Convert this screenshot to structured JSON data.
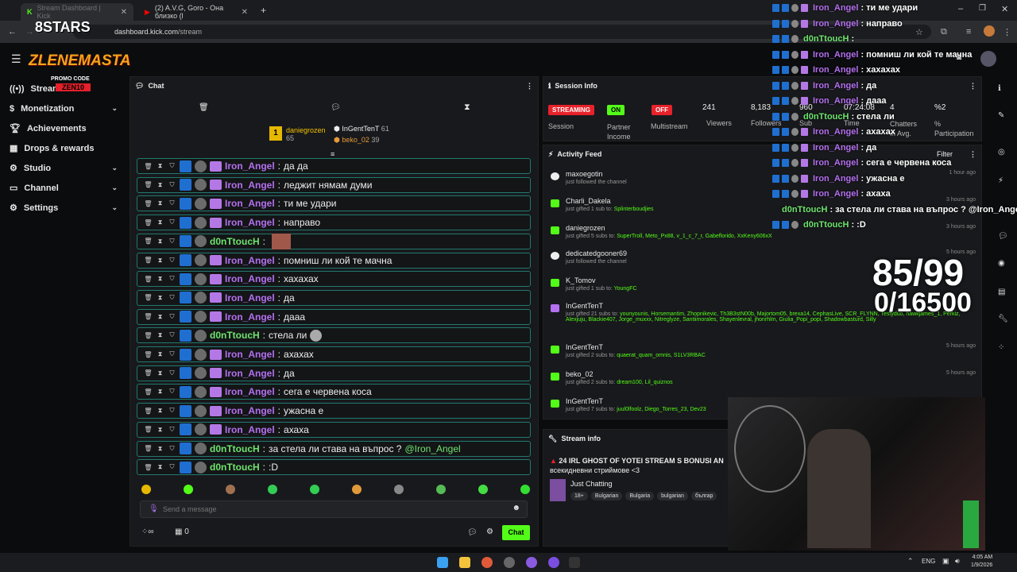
{
  "browser": {
    "tabs": [
      {
        "label": "Stream Dashboard | Kick"
      },
      {
        "label": "(2) A.V.G, Goro - Она близко (l"
      }
    ],
    "url_prefix": "dashboard.kick.com",
    "url_path": "/stream"
  },
  "logo": {
    "brand": "8STARS",
    "streamer": "ZLENEMASTA",
    "promo": "PROMO CODE",
    "code": "ZEN10"
  },
  "sidebar": {
    "items": [
      {
        "label": "Stream",
        "icon": "broadcast-icon"
      },
      {
        "label": "Monetization",
        "icon": "dollar-icon",
        "chevron": true
      },
      {
        "label": "Achievements",
        "icon": "trophy-icon"
      },
      {
        "label": "Drops & rewards",
        "icon": "gift-icon"
      },
      {
        "label": "Studio",
        "icon": "gear-icon",
        "chevron": true
      },
      {
        "label": "Channel",
        "icon": "tv-icon",
        "chevron": true
      },
      {
        "label": "Settings",
        "icon": "gear-icon",
        "chevron": true
      }
    ]
  },
  "chat": {
    "title": "Chat",
    "leaders": [
      {
        "name": "daniegrozen",
        "count": "65"
      },
      {
        "name": "InGentTenT",
        "count": "61"
      },
      {
        "name": "beko_02",
        "count": "39"
      }
    ],
    "rank": "1",
    "messages": [
      {
        "user": "Iron_Angel",
        "text": "да да",
        "color": "purple"
      },
      {
        "user": "Iron_Angel",
        "text": "леджит нямам думи",
        "color": "purple"
      },
      {
        "user": "Iron_Angel",
        "text": "ти ме удари",
        "color": "purple"
      },
      {
        "user": "Iron_Angel",
        "text": "направо",
        "color": "purple"
      },
      {
        "user": "d0nTtoucH",
        "text": "",
        "color": "green",
        "emote": true
      },
      {
        "user": "Iron_Angel",
        "text": "помниш ли кой те мачна",
        "color": "purple"
      },
      {
        "user": "Iron_Angel",
        "text": "хахахах",
        "color": "purple"
      },
      {
        "user": "Iron_Angel",
        "text": "да",
        "color": "purple"
      },
      {
        "user": "Iron_Angel",
        "text": "дааа",
        "color": "purple"
      },
      {
        "user": "d0nTtoucH",
        "text": "стела ли",
        "color": "green",
        "emote2": true
      },
      {
        "user": "Iron_Angel",
        "text": "ахахах",
        "color": "purple"
      },
      {
        "user": "Iron_Angel",
        "text": "да",
        "color": "purple"
      },
      {
        "user": "Iron_Angel",
        "text": "сега е червена коса",
        "color": "purple"
      },
      {
        "user": "Iron_Angel",
        "text": "ужасна е",
        "color": "purple"
      },
      {
        "user": "Iron_Angel",
        "text": "ахаха",
        "color": "purple"
      },
      {
        "user": "d0nTtoucH",
        "text": "за стела ли става на въпрос ?",
        "mention": "@Iron_Angel",
        "color": "green"
      },
      {
        "user": "d0nTtoucH",
        "text": ":D",
        "color": "green"
      }
    ],
    "placeholder": "Send a message",
    "chat_button": "Chat",
    "count": "0"
  },
  "session": {
    "title": "Session Info",
    "items": [
      {
        "badge": "STREAMING",
        "label": "Session"
      },
      {
        "badge": "ON",
        "label": "Partner Income"
      },
      {
        "badge": "OFF",
        "label": "Multistream"
      },
      {
        "value": "241",
        "label": "Viewers"
      },
      {
        "value": "8,183",
        "label": "Followers"
      },
      {
        "value": "960",
        "label": "Sub"
      },
      {
        "value": "07:24:08",
        "label": "Time"
      },
      {
        "value": "4",
        "label": "Chatters in Avg."
      },
      {
        "value": "%2",
        "label": "% Participation"
      }
    ]
  },
  "feed": {
    "title": "Activity Feed",
    "filter": "Filter",
    "events": [
      {
        "name": "maxoegotin",
        "desc": "just followed the channel",
        "time": "1 hour ago",
        "type": "follow"
      },
      {
        "name": "Charli_Dakela",
        "desc": "just gifted 1 sub to:",
        "targets": "Splinterboudjies",
        "time": "3 hours ago",
        "type": "gift"
      },
      {
        "name": "daniegrozen",
        "desc": "just gifted 5 subs to:",
        "targets": "SuperTroll, Meto_Px88, v_1_c_7_r, Gabeflorido, XxKeny606xX",
        "time": "3 hours ago",
        "type": "gift"
      },
      {
        "name": "dedicatedgooner69",
        "desc": "just followed the channel",
        "time": "5 hours ago",
        "type": "follow"
      },
      {
        "name": "K_Tomov",
        "desc": "just gifted 1 sub to:",
        "targets": "YoungFC",
        "time": "",
        "type": "gift"
      },
      {
        "name": "InGentTenT",
        "desc": "just gifted 21 subs to:",
        "targets": "younyounis, Horsemantim, Zhopnikevic, Th3B3stN00b, Majortom05, brexa14, CephasLive, SCR_FLYNN, Testyduo, hawkjames_1, Perkiz, Alexjuju, Blackie407, Jorge_muxxx, Nitreglyze, Santiimorales, Shayenlevral, jhonrhlm, Giulia_Popi_popi, Shadowbasturd, Silly",
        "time": "",
        "type": "gift2"
      },
      {
        "name": "InGentTenT",
        "desc": "just gifted 2 subs to:",
        "targets": "quaerat_quam_omnis, S1LV3RBAC",
        "time": "5 hours ago",
        "type": "gift"
      },
      {
        "name": "beko_02",
        "desc": "just gifted 2 subs to:",
        "targets": "dream100, Lil_quiznos",
        "time": "5 hours ago",
        "type": "gift"
      },
      {
        "name": "InGentTenT",
        "desc": "just gifted 7 subs to:",
        "targets": "juul0lfoolz, Diego_Torres_23, Dev23",
        "time": "",
        "type": "gift"
      }
    ]
  },
  "stream_info": {
    "title": "Stream info",
    "headline": "24 IRL GHOST OF YOTEI STREAM S BONUSI AN",
    "sub": "всекидневни стриймове <3",
    "category": "Just Chatting",
    "tags": [
      "18+",
      "Bulgarian",
      "Bulgaria",
      "bulgarian",
      "българ"
    ]
  },
  "overlay": {
    "messages": [
      {
        "user": "Iron_Angel",
        "text": ": ти ме удари"
      },
      {
        "user": "Iron_Angel",
        "text": ": направо"
      },
      {
        "user": "d0nTtoucH",
        "text": ":"
      },
      {
        "user": "Iron_Angel",
        "text": ": помниш ли кой те мачна"
      },
      {
        "user": "Iron_Angel",
        "text": ": хахахах"
      },
      {
        "user": "Iron_Angel",
        "text": ": да"
      },
      {
        "user": "Iron_Angel",
        "text": ": дааа"
      },
      {
        "user": "d0nTtoucH",
        "text": ": стела ли"
      },
      {
        "user": "Iron_Angel",
        "text": ": ахахах"
      },
      {
        "user": "Iron_Angel",
        "text": ": да"
      },
      {
        "user": "Iron_Angel",
        "text": ": сега е червена коса"
      },
      {
        "user": "Iron_Angel",
        "text": ": ужасна е"
      },
      {
        "user": "Iron_Angel",
        "text": ": ахаха"
      },
      {
        "user": "d0nTtoucH",
        "text": ": за стела ли става на въпрос ? @Iron_Angel"
      },
      {
        "user": "d0nTtoucH",
        "text": ": :D"
      }
    ],
    "goal1": "85/99",
    "goal2": "0/16500"
  },
  "taskbar": {
    "lang": "ENG",
    "time": "4:05 AM",
    "date": "1/9/2026"
  },
  "colors": {
    "accent": "#53fc18",
    "purple": "#b470f0",
    "streaming": "#e8222b"
  }
}
